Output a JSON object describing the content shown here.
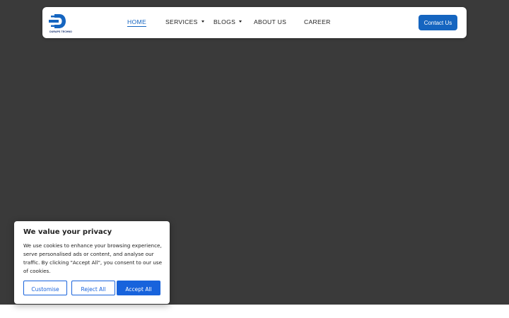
{
  "brand": {
    "logo_text": "DURAPS TECHNO",
    "accent": "#1565c0"
  },
  "nav": {
    "items": [
      {
        "label": "HOME",
        "active": true
      },
      {
        "label": "SERVICES",
        "dropdown": true
      },
      {
        "label": "BLOGS",
        "dropdown": true
      },
      {
        "label": "ABOUT US"
      },
      {
        "label": "CAREER"
      }
    ],
    "contact_label": "Contact Us"
  },
  "cookie": {
    "title": "We value your privacy",
    "body": "We use cookies to enhance your browsing experience, serve personalised ads or content, and analyse our traffic. By clicking \"Accept All\", you consent to our use of cookies.",
    "customise_label": "Customise",
    "reject_label": "Reject All",
    "accept_label": "Accept All",
    "button_color": "#1863dc"
  }
}
